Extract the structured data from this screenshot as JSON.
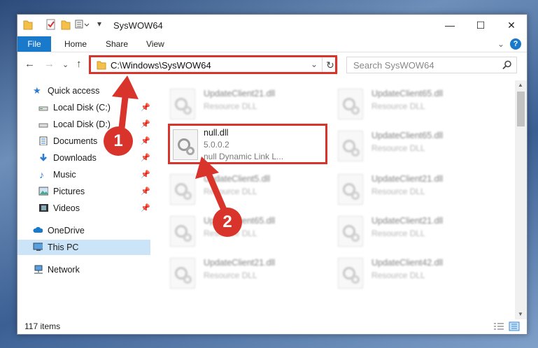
{
  "window": {
    "title": "SysWOW64",
    "controls": {
      "minimize": "—",
      "maximize": "☐",
      "close": "✕"
    }
  },
  "ribbon": {
    "tabs": [
      "File",
      "Home",
      "Share",
      "View"
    ],
    "collapse": "⌄",
    "help": "?"
  },
  "nav": {
    "back": "←",
    "forward": "→",
    "recent": "⌄",
    "up": "↑",
    "address": "C:\\Windows\\SysWOW64",
    "address_dropdown": "⌄",
    "refresh": "↻",
    "search_placeholder": "Search SysWOW64"
  },
  "sidebar": {
    "items": [
      {
        "label": "Quick access",
        "icon": "star-icon"
      },
      {
        "label": "Local Disk (C:)",
        "icon": "drive-icon"
      },
      {
        "label": "Local Disk (D:)",
        "icon": "drive-icon"
      },
      {
        "label": "Documents",
        "icon": "documents-icon"
      },
      {
        "label": "Downloads",
        "icon": "download-icon"
      },
      {
        "label": "Music",
        "icon": "music-icon"
      },
      {
        "label": "Pictures",
        "icon": "pictures-icon"
      },
      {
        "label": "Videos",
        "icon": "videos-icon"
      },
      {
        "label": "OneDrive",
        "icon": "cloud-icon"
      },
      {
        "label": "This PC",
        "icon": "computer-icon"
      },
      {
        "label": "Network",
        "icon": "network-icon"
      }
    ]
  },
  "files": {
    "left": [
      {
        "name": "UpdateClient21.dll",
        "type": "Resource DLL"
      },
      {
        "name": "null.dll",
        "version": "5.0.0.2",
        "desc": "null Dynamic Link L..."
      },
      {
        "name": "UpdateClient5.dll",
        "type": "Resource DLL"
      },
      {
        "name": "UpdateClient65.dll",
        "type": "Resource DLL"
      },
      {
        "name": "UpdateClient21.dll",
        "type": "Resource DLL"
      }
    ],
    "right": [
      {
        "name": "UpdateClient65.dll",
        "type": "Resource DLL"
      },
      {
        "name": "UpdateClient65.dll",
        "type": "Resource DLL"
      },
      {
        "name": "UpdateClient21.dll",
        "type": "Resource DLL"
      },
      {
        "name": "UpdateClient21.dll",
        "type": "Resource DLL"
      },
      {
        "name": "UpdateClient42.dll",
        "type": "Resource DLL"
      }
    ]
  },
  "status": {
    "count": "117 items"
  },
  "annotations": {
    "step1": "1",
    "step2": "2",
    "color": "#d9342b"
  }
}
